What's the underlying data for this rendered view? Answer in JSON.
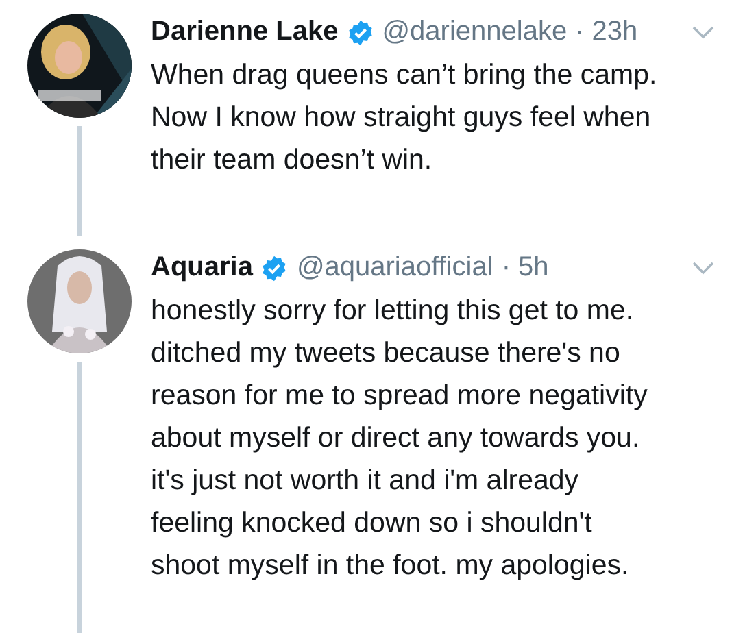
{
  "tweets": [
    {
      "name": "Darienne Lake",
      "verified": true,
      "handle": "@dariennelake",
      "time": "· 23h",
      "lines": [
        "When drag queens can’t bring the camp.",
        "Now I know how straight guys feel when",
        "their team doesn’t win."
      ]
    },
    {
      "name": "Aquaria",
      "verified": true,
      "handle": "@aquariaofficial",
      "time": "· 5h",
      "lines": [
        "honestly sorry for letting this get to me.",
        "ditched my tweets because there's no",
        "reason for me to spread more negativity",
        "about myself or direct any towards you.",
        "it's just not worth it and i'm already",
        "feeling knocked down so i shouldn't",
        "shoot myself in the foot. my apologies."
      ]
    }
  ]
}
